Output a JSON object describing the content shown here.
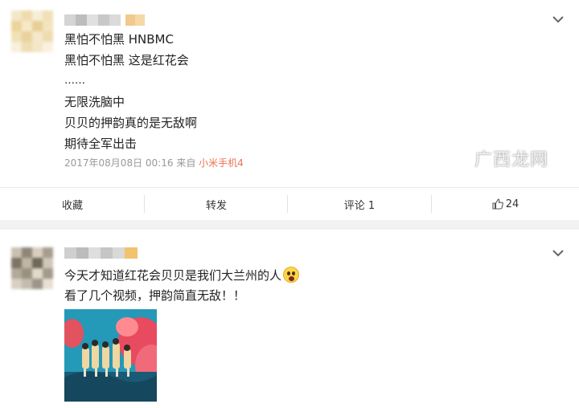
{
  "posts": [
    {
      "lines": [
        "黑怕不怕黑 HNBMC",
        "黑怕不怕黑 这是红花会",
        "……",
        "无限洗脑中",
        "贝贝的押韵真的是无敌啊",
        "期待全军出击"
      ],
      "meta": {
        "timestamp": "2017年08月08日 00:16",
        "from_label": "来自",
        "source": "小米手机4"
      },
      "actions": {
        "favorite": "收藏",
        "repost": "转发",
        "comment": "评论 1",
        "like_count": "24"
      }
    },
    {
      "line1": "今天才知道红花会贝贝是我们大兰州的人",
      "line2": "看了几个视频，押韵简直无敌！！"
    }
  ],
  "icons": {
    "expand": "chevron-down-icon",
    "like": "thumbs-up-icon",
    "emoji": "fearful-face-emoji"
  },
  "watermark": {
    "text": "广西龙网"
  },
  "colors": {
    "source_link": "#eb7350",
    "meta_text": "#999999",
    "page_background": "#f2f2f2"
  }
}
